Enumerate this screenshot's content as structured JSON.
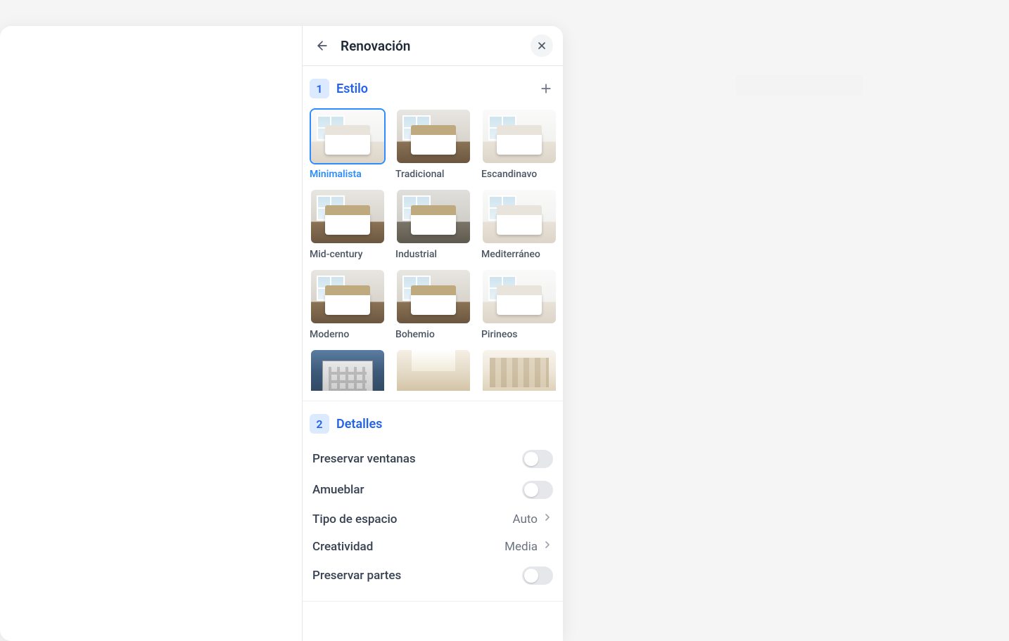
{
  "header": {
    "title": "Renovación"
  },
  "section_style": {
    "step": "1",
    "title": "Estilo",
    "items": [
      {
        "label": "Minimalista",
        "selected": true,
        "variant": "light"
      },
      {
        "label": "Tradicional",
        "selected": false,
        "variant": "dark"
      },
      {
        "label": "Escandinavo",
        "selected": false,
        "variant": "light"
      },
      {
        "label": "Mid-century",
        "selected": false,
        "variant": "dark"
      },
      {
        "label": "Industrial",
        "selected": false,
        "variant": "industrial"
      },
      {
        "label": "Mediterráneo",
        "selected": false,
        "variant": "light"
      },
      {
        "label": "Moderno",
        "selected": false,
        "variant": "dark"
      },
      {
        "label": "Bohemio",
        "selected": false,
        "variant": "dark"
      },
      {
        "label": "Pirineos",
        "selected": false,
        "variant": "light"
      },
      {
        "label": "",
        "selected": false,
        "variant": "blue",
        "special": "exterior"
      },
      {
        "label": "",
        "selected": false,
        "variant": "ceiling",
        "special": "ceiling"
      },
      {
        "label": "",
        "selected": false,
        "variant": "store",
        "special": "store"
      }
    ]
  },
  "section_details": {
    "step": "2",
    "title": "Detalles",
    "rows": [
      {
        "type": "toggle",
        "label": "Preservar ventanas",
        "value": false
      },
      {
        "type": "toggle",
        "label": "Amueblar",
        "value": false
      },
      {
        "type": "select",
        "label": "Tipo de espacio",
        "value": "Auto"
      },
      {
        "type": "select",
        "label": "Creatividad",
        "value": "Media"
      },
      {
        "type": "toggle",
        "label": "Preservar partes",
        "value": false
      }
    ]
  }
}
